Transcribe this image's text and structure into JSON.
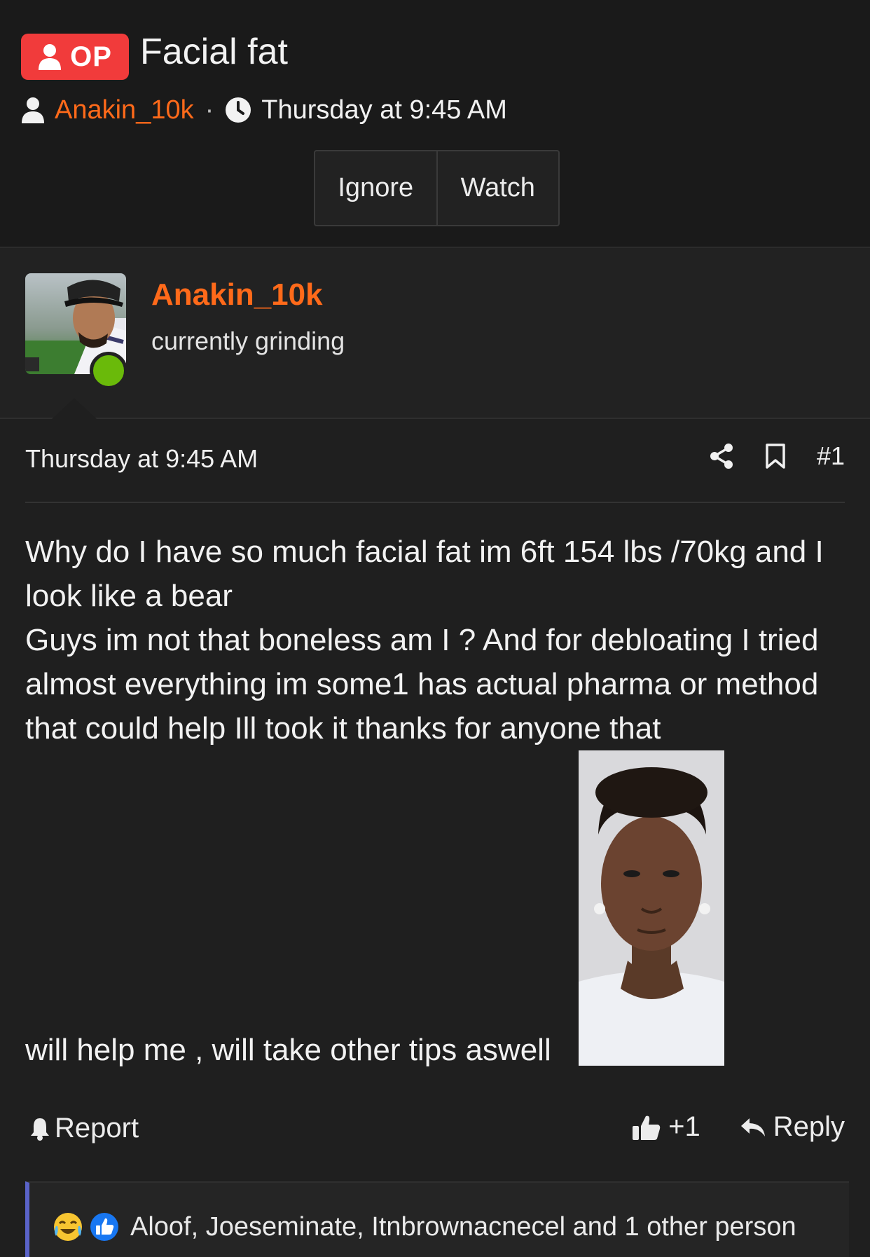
{
  "thread": {
    "badge": "OP",
    "title": "Facial fat",
    "author": "Anakin_10k",
    "separator": "·",
    "time": "Thursday at 9:45 AM",
    "buttons": {
      "ignore": "Ignore",
      "watch": "Watch"
    }
  },
  "author_block": {
    "username": "Anakin_10k",
    "user_title": "currently grinding",
    "online_color": "#6aba0a"
  },
  "post": {
    "time": "Thursday at 9:45 AM",
    "number": "#1",
    "paragraphs": [
      "Why do I have so much facial fat im 6ft 154 lbs /70kg and I look like a bear",
      "Guys im not that boneless am I ? And for debloating I tried almost everything im some1 has actual pharma or method that could help Ill took it thanks for anyone that"
    ],
    "last_line": "will help me , will take other tips aswell",
    "report_label": "Report",
    "like_count": "+1",
    "reply_label": "Reply"
  },
  "reactions": {
    "text": "Aloof, Joeseminate, Itnbrownacnecel and 1 other person",
    "icons": [
      "crying-laughing-emoji-icon",
      "thumbs-up-like-icon"
    ]
  },
  "colors": {
    "accent_orange": "#ff6a1a",
    "op_red": "#f13b3b",
    "background": "#1f1f1f",
    "reaction_bar_accent": "#5a63c8"
  }
}
